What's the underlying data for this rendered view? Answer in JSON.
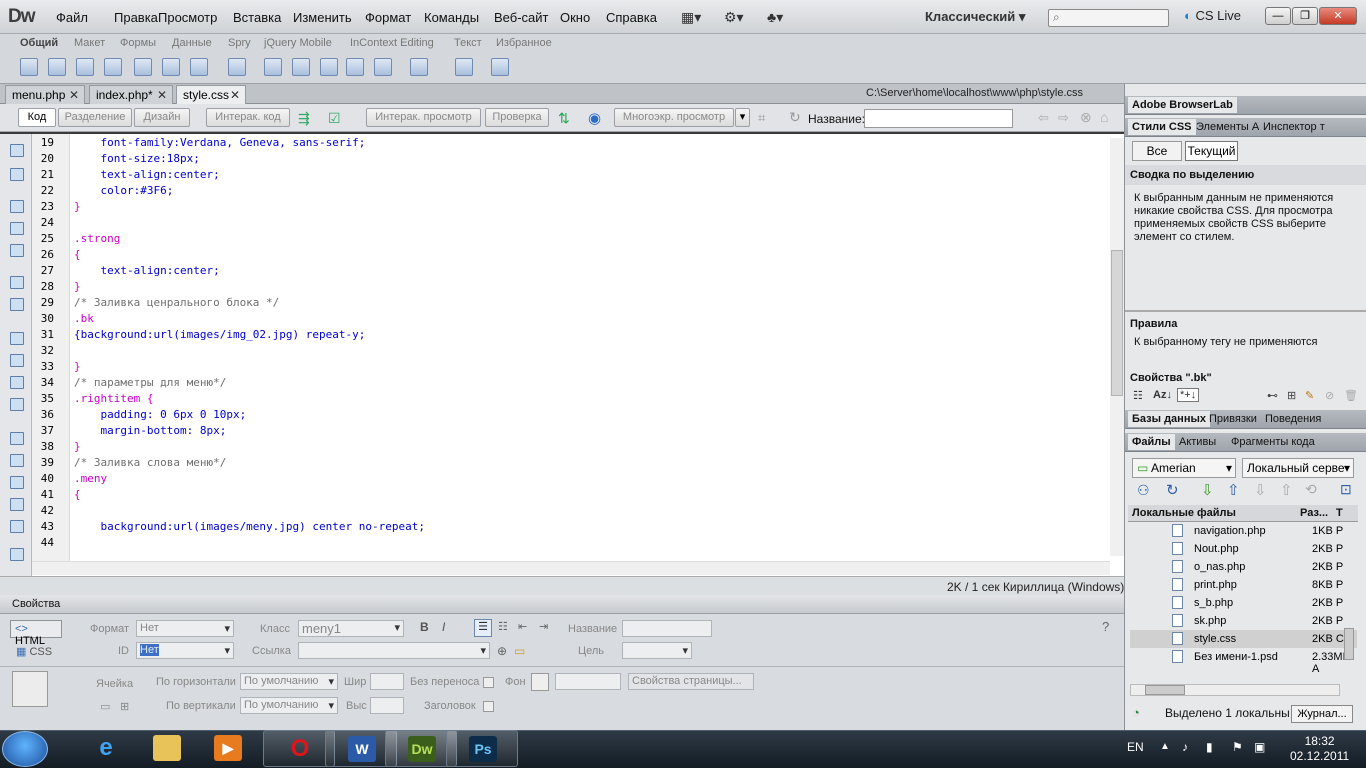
{
  "app": {
    "logo": "Dw",
    "menu": [
      "Файл",
      "Правка",
      "Просмотр",
      "Вставка",
      "Изменить",
      "Формат",
      "Команды",
      "Веб-сайт",
      "Окно",
      "Справка"
    ],
    "workspace": "Классический",
    "cs_live": "CS Live"
  },
  "insert_tabs": [
    "Общий",
    "Макет",
    "Формы",
    "Данные",
    "Spry",
    "jQuery Mobile",
    "InContext Editing",
    "Текст",
    "Избранное"
  ],
  "doc_tabs": [
    {
      "name": "menu.php",
      "active": false
    },
    {
      "name": "index.php*",
      "active": false
    },
    {
      "name": "style.css",
      "active": true
    }
  ],
  "file_path": "C:\\Server\\home\\localhost\\www\\php\\style.css",
  "doc_toolbar": {
    "code": "Код",
    "split": "Разделение",
    "design": "Дизайн",
    "live_code": "Интерак. код",
    "live_view": "Интерак. просмотр",
    "inspect": "Проверка",
    "multiscreen": "Многоэкр. просмотр",
    "name_label": "Название:"
  },
  "code_lines": [
    {
      "n": "19",
      "t": "    font-family:Verdana, Geneva, sans-serif;",
      "k": "prop"
    },
    {
      "n": "20",
      "t": "    font-size:18px;",
      "k": "prop"
    },
    {
      "n": "21",
      "t": "    text-align:center;",
      "k": "prop"
    },
    {
      "n": "22",
      "t": "    color:#3F6;",
      "k": "prop"
    },
    {
      "n": "23",
      "t": "}",
      "k": "brace"
    },
    {
      "n": "24",
      "t": "",
      "k": "prop"
    },
    {
      "n": "25",
      "t": ".strong",
      "k": "sel"
    },
    {
      "n": "26",
      "t": "{",
      "k": "brace"
    },
    {
      "n": "27",
      "t": "    text-align:center;",
      "k": "prop"
    },
    {
      "n": "28",
      "t": "}",
      "k": "brace"
    },
    {
      "n": "29",
      "t": "/* Заливка ценрального блока */",
      "k": "com"
    },
    {
      "n": "30",
      "t": ".bk",
      "k": "sel"
    },
    {
      "n": "31",
      "t": "{background:url(images/img_02.jpg) repeat-y;",
      "k": "prop"
    },
    {
      "n": "32",
      "t": "",
      "k": "prop"
    },
    {
      "n": "33",
      "t": "}",
      "k": "brace"
    },
    {
      "n": "34",
      "t": "/* параметры для меню*/",
      "k": "com"
    },
    {
      "n": "35",
      "t": ".rightitem {",
      "k": "sel"
    },
    {
      "n": "36",
      "t": "    padding: 0 6px 0 10px;",
      "k": "prop"
    },
    {
      "n": "37",
      "t": "    margin-bottom: 8px;",
      "k": "prop"
    },
    {
      "n": "38",
      "t": "}",
      "k": "brace"
    },
    {
      "n": "39",
      "t": "/* Заливка слова меню*/",
      "k": "com"
    },
    {
      "n": "40",
      "t": ".meny",
      "k": "sel"
    },
    {
      "n": "41",
      "t": "{",
      "k": "brace"
    },
    {
      "n": "42",
      "t": "",
      "k": "prop"
    },
    {
      "n": "43",
      "t": "    background:url(images/meny.jpg) center no-repeat;",
      "k": "prop"
    },
    {
      "n": "44",
      "t": "",
      "k": "prop"
    }
  ],
  "status": "2K / 1 сек  Кириллица (Windows)",
  "properties": {
    "title": "Свойства",
    "html": "HTML",
    "css": "CSS",
    "format_label": "Формат",
    "format_value": "Нет",
    "class_label": "Класс",
    "class_value": "meny1",
    "id_label": "ID",
    "id_value": "Нет",
    "link_label": "Ссылка",
    "name_label": "Название",
    "target_label": "Цель",
    "cell_label": "Ячейка",
    "horiz_label": "По горизонтали",
    "horiz_value": "По умолчанию",
    "vert_label": "По вертикали",
    "vert_value": "По умолчанию",
    "width_label": "Шир",
    "height_label": "Выс",
    "nowrap_label": "Без переноса",
    "bg_label": "Фон",
    "header_label": "Заголовок",
    "page_props": "Свойства страницы..."
  },
  "right": {
    "browserlab": "Adobe BrowserLab",
    "css_tabs": [
      "Стили CSS",
      "Элементы A",
      "Инспектор т"
    ],
    "all": "Все",
    "current": "Текущий",
    "summary_title": "Сводка по выделению",
    "summary_text": "К выбранным данным не применяются никакие свойства CSS.  Для просмотра применяемых свойств CSS выберите элемент со стилем.",
    "rules_title": "Правила",
    "rules_text": "К выбранному тегу не применяются",
    "props_title": "Свойства \".bk\"",
    "db_tabs": [
      "Базы данных",
      "Привязки",
      "Поведения"
    ],
    "file_tabs": [
      "Файлы",
      "Активы",
      "Фрагменты кода"
    ],
    "site": "Amerian",
    "view": "Локальный серве",
    "col_name": "Локальные файлы",
    "col_size": "Раз...",
    "col_type": "Т",
    "files": [
      {
        "name": "navigation.php",
        "size": "1KB P",
        "sel": false
      },
      {
        "name": "Nout.php",
        "size": "2KB P",
        "sel": false
      },
      {
        "name": "o_nas.php",
        "size": "2KB P",
        "sel": false
      },
      {
        "name": "print.php",
        "size": "8KB P",
        "sel": false
      },
      {
        "name": "s_b.php",
        "size": "2KB P",
        "sel": false
      },
      {
        "name": "sk.php",
        "size": "2KB P",
        "sel": false
      },
      {
        "name": "style.css",
        "size": "2KB C",
        "sel": true
      },
      {
        "name": "Без имени-1.psd",
        "size": "2.33MB A",
        "sel": false
      }
    ],
    "bottom_status": "Выделено 1 локальны",
    "log": "Журнал..."
  },
  "taskbar": {
    "lang": "EN",
    "time": "18:32",
    "date": "02.12.2011",
    "apps": [
      "Internet Explorer",
      "Проводник",
      "Media Player",
      "Opera",
      "Word",
      "Dw",
      "Ps"
    ]
  }
}
